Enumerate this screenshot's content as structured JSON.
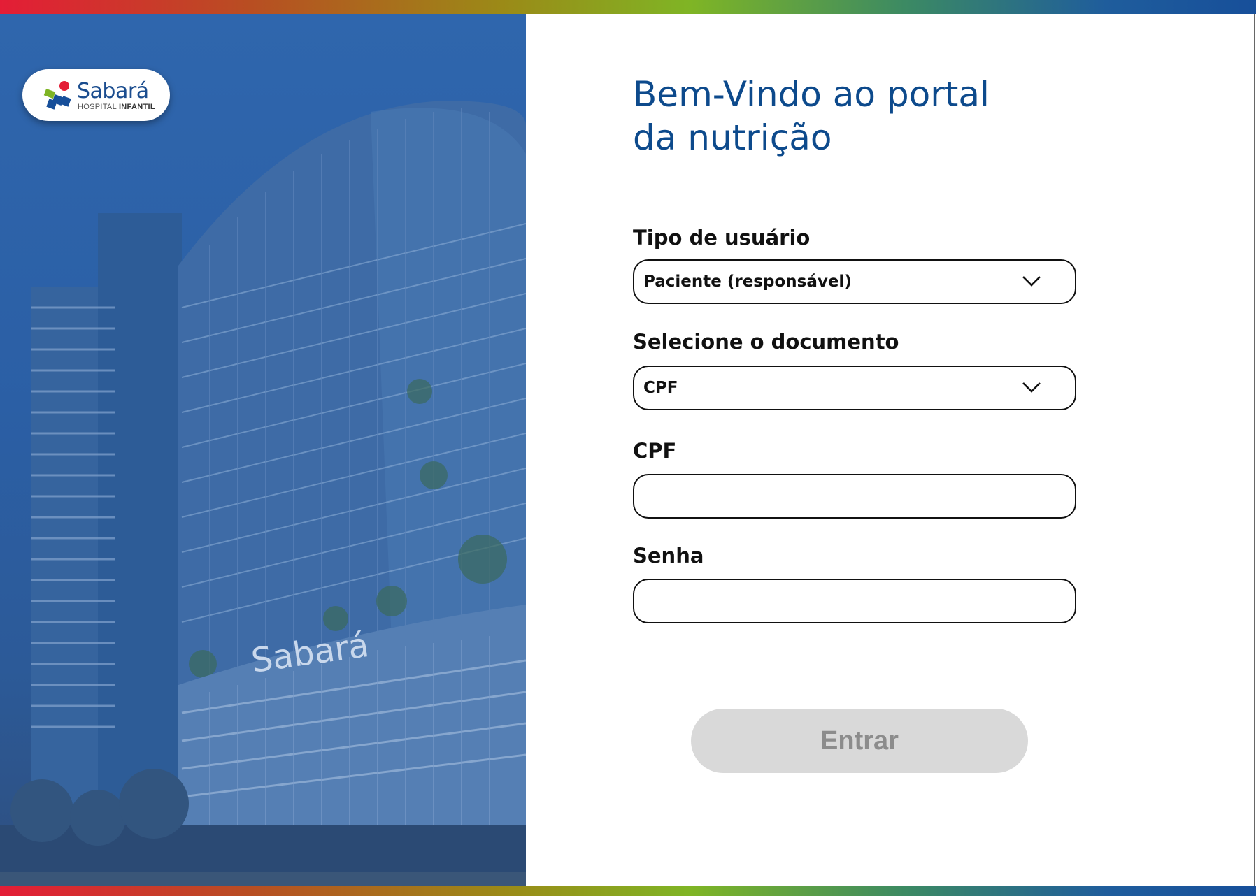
{
  "logo": {
    "brand": "Sabará",
    "subtitle_left": "HOSPITAL",
    "subtitle_right": "INFANTIL"
  },
  "hero": {
    "building_sign": "Sabará"
  },
  "form": {
    "title_line1": "Bem-Vindo ao portal",
    "title_line2": "da nutrição",
    "user_type": {
      "label": "Tipo de usuário",
      "value": "Paciente (responsável)"
    },
    "document": {
      "label": "Selecione o documento",
      "value": "CPF"
    },
    "cpf": {
      "label": "CPF",
      "value": ""
    },
    "password": {
      "label": "Senha",
      "value": ""
    },
    "submit_label": "Entrar"
  },
  "colors": {
    "title": "#0d4a8c",
    "hero_overlay": "#2f66ad",
    "button_disabled_bg": "#d9d9d9",
    "button_disabled_text": "#8c8c8c"
  }
}
